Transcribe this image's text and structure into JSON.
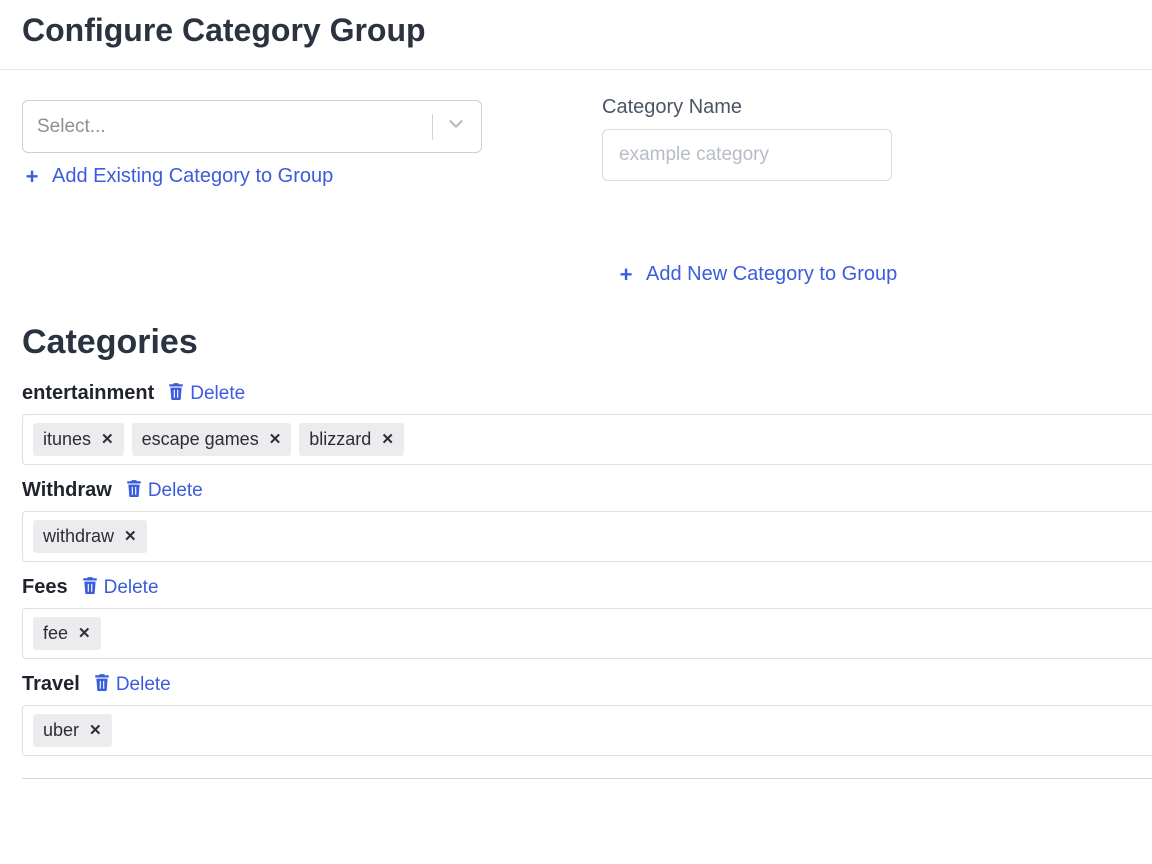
{
  "header": {
    "title": "Configure Category Group"
  },
  "left": {
    "select_placeholder": "Select...",
    "add_existing_label": "Add Existing Category to Group"
  },
  "right": {
    "field_label": "Category Name",
    "input_placeholder": "example category",
    "input_value": "",
    "add_new_label": "Add New Category to Group"
  },
  "section": {
    "title": "Categories",
    "delete_label": "Delete"
  },
  "categories": [
    {
      "name": "entertainment",
      "tags": [
        "itunes",
        "escape games",
        "blizzard"
      ]
    },
    {
      "name": "Withdraw",
      "tags": [
        "withdraw"
      ]
    },
    {
      "name": "Fees",
      "tags": [
        "fee"
      ]
    },
    {
      "name": "Travel",
      "tags": [
        "uber"
      ]
    }
  ]
}
